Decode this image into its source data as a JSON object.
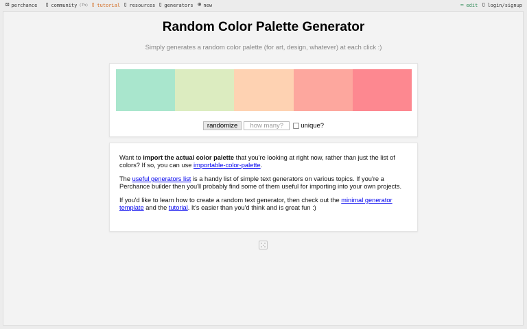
{
  "topbar": {
    "brand": "perchance",
    "community": "community",
    "community_count": "(7h)",
    "tutorial": "tutorial",
    "resources": "resources",
    "generators": "generators",
    "new": "new",
    "edit": "edit",
    "login": "login/signup"
  },
  "page": {
    "title": "Random Color Palette Generator",
    "subtitle": "Simply generates a random color palette (for art, design, whatever) at each click :)"
  },
  "palette": {
    "colors": [
      "#a9e6cd",
      "#dcecc0",
      "#fed2b2",
      "#fda79e",
      "#fd8890"
    ]
  },
  "controls": {
    "randomize_label": "randomize",
    "count_placeholder": "how many?",
    "unique_label": "unique?"
  },
  "info": {
    "p1_a": "Want to ",
    "p1_bold": "import the actual color palette",
    "p1_b": " that you're looking at right now, rather than just the list of colors? If so, you can use ",
    "p1_link": "importable-color-palette",
    "p1_c": ".",
    "p2_a": "The ",
    "p2_link": "useful generators list",
    "p2_b": " is a handy list of simple text generators on various topics. If you're a Perchance builder then you'll probably find some of them useful for importing into your own projects.",
    "p3_a": "If you'd like to learn how to create a random text generator, then check out the ",
    "p3_link1": "minimal generator template",
    "p3_b": " and the ",
    "p3_link2": "tutorial",
    "p3_c": ". It's easier than you'd think and is great fun :)"
  }
}
